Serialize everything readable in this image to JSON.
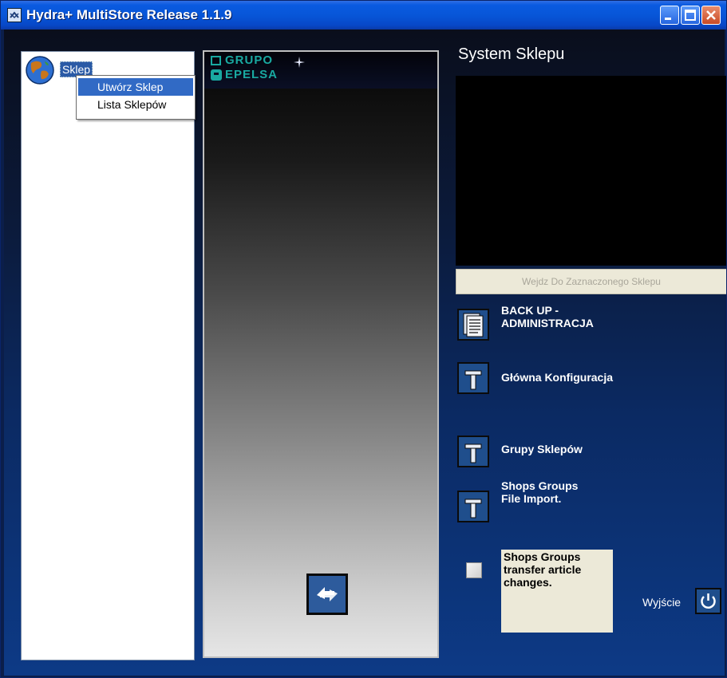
{
  "window": {
    "title": "Hydra+ MultiStore Release 1.1.9"
  },
  "tree": {
    "root_label": "Sklep"
  },
  "context_menu": {
    "items": [
      "Utwórz Sklep",
      "Lista Sklepów"
    ]
  },
  "logo": {
    "line1": "GRUPO",
    "line2": "EPELSA"
  },
  "main": {
    "title": "System Sklepu",
    "enter_button": "Wejdz Do Zaznaczonego Sklepu",
    "backup_label_1": "BACK UP  -",
    "backup_label_2": "ADMINISTRACJA",
    "config_label": "Główna Konfiguracja",
    "groups_label": "Grupy Sklepów",
    "import_label_1": "Shops Groups",
    "import_label_2": "File Import.",
    "transfer_label_1": "Shops Groups",
    "transfer_label_2": "transfer article",
    "transfer_label_3": "changes.",
    "exit_label": "Wyjście"
  },
  "colors": {
    "title_bar": "#0756d8",
    "selection": "#316ac5",
    "button_bg": "#1f4e8c",
    "logo_text": "#19a9a1"
  },
  "icons": [
    "app-icon",
    "globe-icon",
    "minimize-icon",
    "maximize-icon",
    "close-icon",
    "backup-document-icon",
    "config-tool-icon",
    "power-icon",
    "refresh-arrows-icon"
  ]
}
